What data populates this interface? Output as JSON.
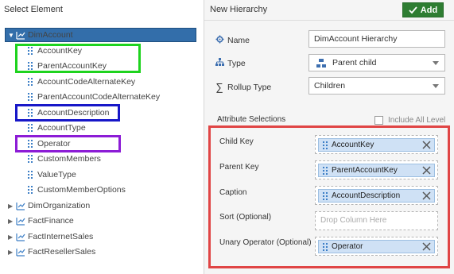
{
  "left": {
    "title": "Select Element",
    "tree": {
      "root": "DimAccount",
      "children": [
        "AccountKey",
        "ParentAccountKey",
        "AccountCodeAlternateKey",
        "ParentAccountCodeAlternateKey",
        "AccountDescription",
        "AccountType",
        "Operator",
        "CustomMembers",
        "ValueType",
        "CustomMemberOptions"
      ],
      "collapsed": [
        "DimOrganization",
        "FactFinance",
        "FactInternetSales",
        "FactResellerSales"
      ]
    }
  },
  "right": {
    "title": "New Hierarchy",
    "add_label": "Add",
    "name_label": "Name",
    "name_value": "DimAccount Hierarchy",
    "type_label": "Type",
    "type_value": "Parent child",
    "rollup_label": "Rollup Type",
    "rollup_value": "Children",
    "attr_label": "Attribute Selections",
    "include_all_label": "Include All Level",
    "mappings": [
      {
        "label": "Child Key",
        "value": "AccountKey"
      },
      {
        "label": "Parent Key",
        "value": "ParentAccountKey"
      },
      {
        "label": "Caption",
        "value": "AccountDescription"
      },
      {
        "label": "Sort (Optional)",
        "placeholder": "Drop Column Here"
      },
      {
        "label": "Unary Operator (Optional)",
        "value": "Operator"
      }
    ]
  },
  "colors": {
    "selected_row": "#336eaa",
    "add_button": "#2e7d32",
    "highlight_green": "#1ed31e",
    "highlight_blue": "#1717c8",
    "highlight_purple": "#8c1cd6",
    "highlight_red": "#e04545",
    "chip": "#cfe1f5"
  }
}
